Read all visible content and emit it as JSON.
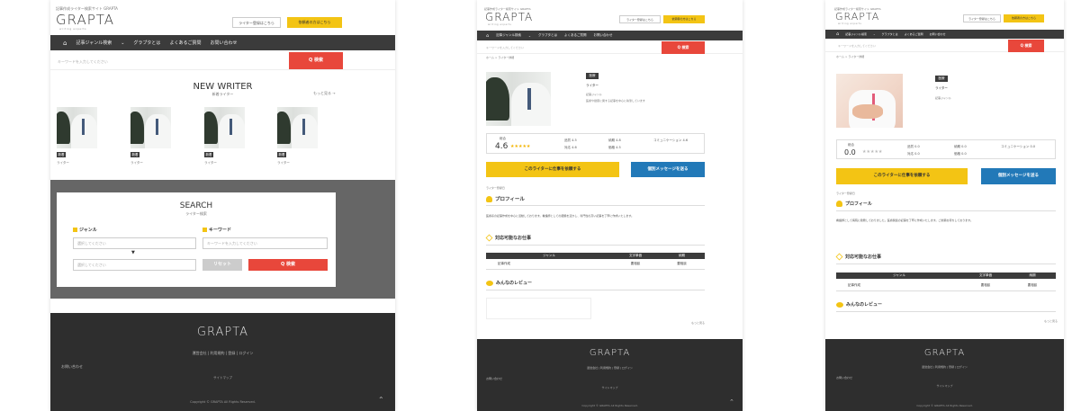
{
  "site": {
    "logo": "GRAPTA",
    "logo_sub": "writing experts",
    "tagline": "記事作成ライター検索サイト GRAPTA",
    "btn_writer_register": "ライター登録はこちら",
    "btn_client_register": "依頼者の方はこちら",
    "nav": {
      "home_icon": "house-icon",
      "genre": "記事ジャンル検索",
      "about": "グラプタとは",
      "faq": "よくあるご質問",
      "contact": "お問い合わせ"
    },
    "search_placeholder": "キーワードを入力してください",
    "search_btn": "Q 検索"
  },
  "page1": {
    "section_title": "NEW WRITER",
    "section_sub": "新着ライター",
    "more_link": "もっと見る →",
    "writers": [
      {
        "tag": "新着",
        "name": "ライター"
      },
      {
        "tag": "新着",
        "name": "ライター"
      },
      {
        "tag": "新着",
        "name": "ライター"
      },
      {
        "tag": "新着",
        "name": "ライター"
      }
    ],
    "search": {
      "title": "SEARCH",
      "sub": "ライター検索",
      "genre_label": "ジャンル",
      "keyword_label": "キーワード",
      "genre_placeholder_1": "選択してください",
      "genre_placeholder_2": "選択してください",
      "keyword_placeholder": "キーワードを入力してください",
      "reset_btn": "リセット",
      "search_btn": "Q 検索"
    }
  },
  "page2": {
    "breadcrumb": "ホーム > ライター詳細",
    "tag": "医療",
    "name": "ライター",
    "meta": "記事ジャンル",
    "desc": "医療や健康に関する記事を中心に執筆しています",
    "rating": {
      "label": "総合",
      "score": "4.6",
      "stars": "★★★★★",
      "items": [
        "品質 4.5",
        "納期 4.8",
        "コミュニケーション 4.6",
        "対応 4.6",
        "価格 4.5"
      ]
    },
    "btn_request": "このライターに仕事を依頼する",
    "btn_message": "個別メッセージを送る",
    "small_note": "ライター登録日",
    "profile_title": "プロフィール",
    "profile_text": "医療系の記事作成を中心に活動しております。看護師としての経験を活かし、専門性の高い記事を丁寧に作成いたします。",
    "jobs_title": "対応可能なお仕事",
    "jobs_cols": [
      "ジャンル",
      "文字単価",
      "納期"
    ],
    "jobs_row": [
      "記事作成",
      "要相談",
      "要相談"
    ],
    "review_title": "みんなのレビュー",
    "more": "もっと見る"
  },
  "page3": {
    "breadcrumb": "ホーム > ライター詳細",
    "tag": "医療",
    "name": "ライター",
    "meta": "記事ジャンル",
    "rating": {
      "label": "総合",
      "score": "0.0",
      "stars": "★★★★★",
      "items": [
        "品質 0.0",
        "納期 0.0",
        "コミュニケーション 0.0",
        "対応 0.0",
        "価格 0.0"
      ]
    },
    "btn_request": "このライターに仕事を依頼する",
    "btn_message": "個別メッセージを送る",
    "small_note": "ライター登録日",
    "profile_title": "プロフィール",
    "profile_text": "看護師として病院に勤務しておりました。医療関連の記事を丁寧に作成いたします。ご依頼お待ちしております。",
    "jobs_title": "対応可能なお仕事",
    "jobs_cols": [
      "ジャンル",
      "文字単価",
      "納期"
    ],
    "jobs_row": [
      "記事作成",
      "要相談",
      "要相談"
    ],
    "review_title": "みんなのレビュー",
    "more": "もっと見る"
  },
  "footer": {
    "logo": "GRAPTA",
    "logo_sub": "writing experts",
    "links": "運営会社 | 利用規約 | 登録 | ログイン",
    "left_link": "お問い合わせ",
    "center": "サイトマップ",
    "copy": "Copyright © GRAPTA All Rights Reserved."
  }
}
